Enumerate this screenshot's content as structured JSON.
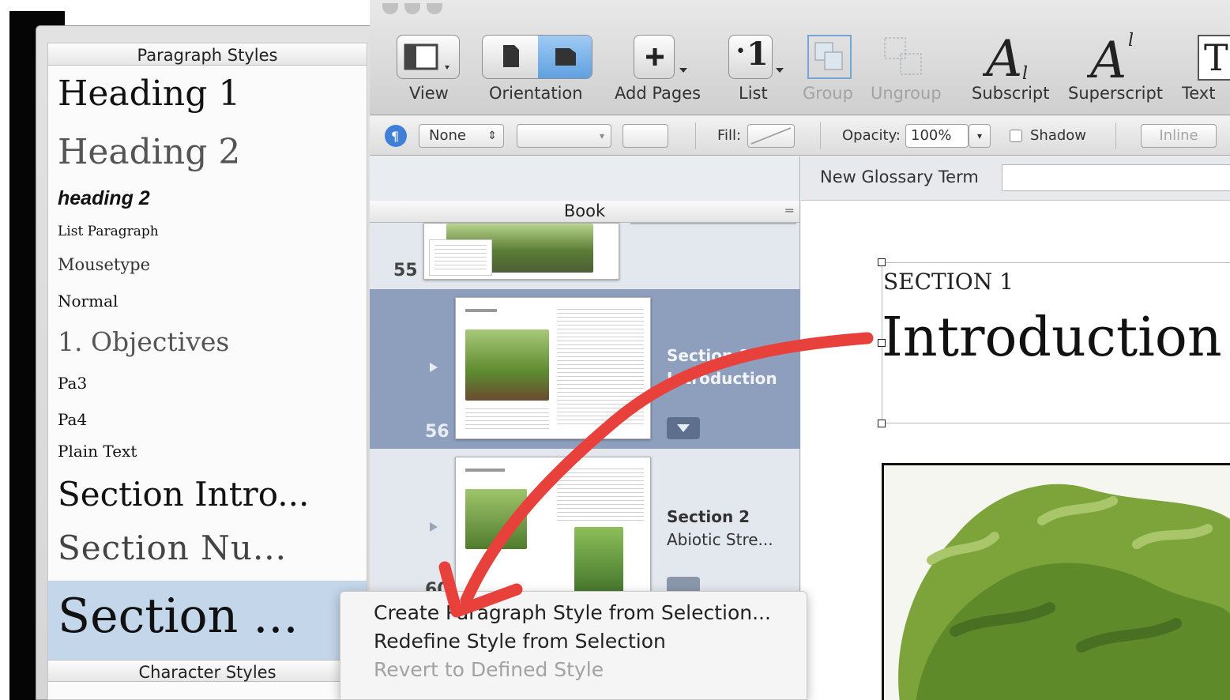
{
  "styles_drawer": {
    "paragraph_header": "Paragraph Styles",
    "character_header": "Character Styles",
    "items": [
      {
        "label": "Heading 1"
      },
      {
        "label": "Heading 2"
      },
      {
        "label": "heading 2"
      },
      {
        "label": "List Paragraph"
      },
      {
        "label": "Mousetype"
      },
      {
        "label": "Normal"
      },
      {
        "label": "1. Objectives"
      },
      {
        "label": "Pa3"
      },
      {
        "label": "Pa4"
      },
      {
        "label": "Plain Text"
      },
      {
        "label": "Section Intro..."
      },
      {
        "label": "Section Nu..."
      },
      {
        "label": "Section ..."
      }
    ],
    "selected_item": "Section ..."
  },
  "toolbar": {
    "view": "View",
    "orientation": "Orientation",
    "add_pages": "Add Pages",
    "list": "List",
    "group": "Group",
    "ungroup": "Ungroup",
    "subscript": "Subscript",
    "superscript": "Superscript",
    "text": "Text",
    "list_glyph": "1",
    "text_glyph": "T"
  },
  "format_bar": {
    "paragraph_style_value": "None",
    "fill_label": "Fill:",
    "opacity_label": "Opacity:",
    "opacity_value": "100%",
    "shadow_label": "Shadow",
    "inline_label": "Inline"
  },
  "book_panel": {
    "header": "Book",
    "pages": [
      {
        "number": "55",
        "title": "",
        "subtitle": ""
      },
      {
        "number": "56",
        "title": "Section 1",
        "subtitle": "Introduction",
        "selected": true
      },
      {
        "number": "60",
        "title": "Section 2",
        "subtitle": "Abiotic Stre..."
      }
    ]
  },
  "document": {
    "glossary_label": "New Glossary Term",
    "section_label": "SECTION 1",
    "heading": "Introduction"
  },
  "context_menu": {
    "items": [
      {
        "label": "Create Paragraph Style from Selection...",
        "enabled": true
      },
      {
        "label": "Redefine Style from Selection",
        "enabled": true
      },
      {
        "label": "Revert to Defined Style",
        "enabled": false
      }
    ]
  },
  "colors": {
    "annotation_arrow": "#e8403a",
    "selection_highlight": "#c3d6ea",
    "selected_page_row": "#8e9fbd"
  }
}
